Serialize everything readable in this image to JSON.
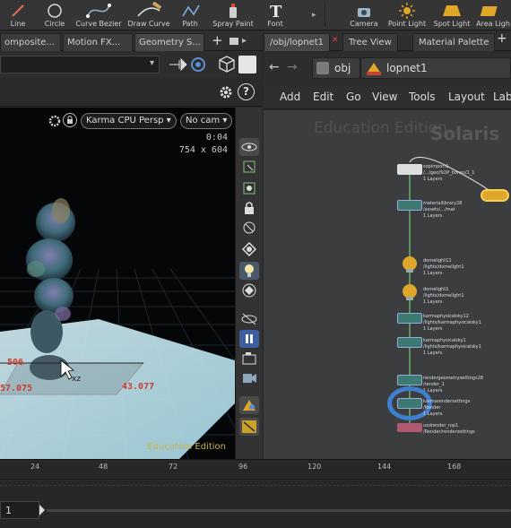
{
  "shelf": {
    "tools": [
      {
        "label": "Line",
        "icon": "line-icon"
      },
      {
        "label": "Circle",
        "icon": "circle-icon"
      },
      {
        "label": "Curve Bezier",
        "icon": "curve-bezier-icon"
      },
      {
        "label": "Draw Curve",
        "icon": "draw-curve-icon"
      },
      {
        "label": "Path",
        "icon": "path-icon"
      },
      {
        "label": "Spray Paint",
        "icon": "spray-paint-icon"
      },
      {
        "label": "Font",
        "icon": "font-icon"
      },
      {
        "label": "Camera",
        "icon": "camera-icon"
      },
      {
        "label": "Point Light",
        "icon": "point-light-icon"
      },
      {
        "label": "Spot Light",
        "icon": "spot-light-icon"
      },
      {
        "label": "Area Ligh",
        "icon": "area-light-icon"
      }
    ]
  },
  "left_pane": {
    "tabs": [
      "omposite...",
      "Motion FX...",
      "Geometry S..."
    ],
    "add_tab": "+",
    "viewport": {
      "renderer": "Karma CPU Persp",
      "camera": "No cam",
      "time": "0:04",
      "resolution": "754 x 604",
      "measure_a": "506",
      "measure_b": "57.075",
      "measure_c": "43.077",
      "axis": "xz",
      "watermark": "Education Edition"
    }
  },
  "right_pane": {
    "tabs": [
      "/obj/lopnet1",
      "Tree View",
      "Material Palette"
    ],
    "path": {
      "root": "obj",
      "node": "lopnet1"
    },
    "menus": [
      "Add",
      "Edit",
      "Go",
      "View",
      "Tools",
      "Layout",
      "Lab"
    ],
    "watermark_edition": "Education Edition",
    "watermark_product": "Solaris",
    "nodes": [
      {
        "name": "sopimport1",
        "detail": "/.../geo/SOP_bones/1_1",
        "layers": "1 Layers",
        "type": "sop"
      },
      {
        "name": "materiallibrary28",
        "detail": "/assets/.../mat",
        "layers": "1 Layers",
        "type": "sop"
      },
      {
        "name": "domelight11",
        "detail": "/lights/domelight1",
        "layers": "1 Layers",
        "type": "light"
      },
      {
        "name": "domelight1",
        "detail": "/lights/domelight1",
        "layers": "1 Layers",
        "type": "light"
      },
      {
        "name": "karmaphysicalsky12",
        "detail": "/lights/karmaphysicalsky1",
        "layers": "1 Layers",
        "type": "sop"
      },
      {
        "name": "karmaphysicalsky1",
        "detail": "/lights/karmaphysicalsky1",
        "layers": "1 Layers",
        "type": "sop"
      },
      {
        "name": "rendergeometrysettings28",
        "detail": "/render_1",
        "layers": "1 Layers",
        "type": "sop"
      },
      {
        "name": "karmarendersettings",
        "detail": "/Render",
        "layers": "1 Layers",
        "type": "selected"
      },
      {
        "name": "usdrender_rop1",
        "detail": "/Render/rendersettings",
        "layers": "",
        "type": "rop"
      }
    ]
  },
  "timeline": {
    "ticks": [
      "24",
      "48",
      "72",
      "96",
      "120",
      "144",
      "168"
    ],
    "current_frame": "1"
  },
  "colors": {
    "accent_yellow": "#e0a62a",
    "node_teal": "#3d7a72",
    "wire_green": "#67b06a",
    "selection_blue": "#3f7fd0",
    "measure_red": "#d0392b"
  }
}
